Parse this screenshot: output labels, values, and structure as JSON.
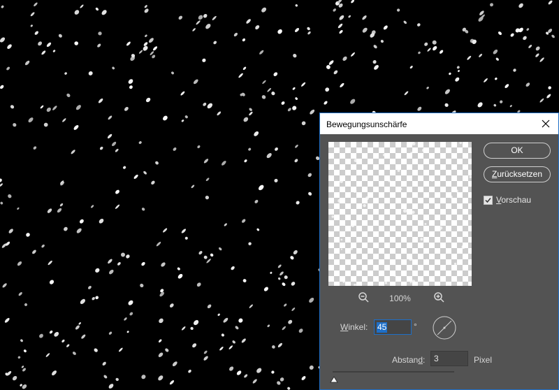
{
  "dialog": {
    "title": "Bewegungsunschärfe",
    "ok_label": "OK",
    "reset_label": "Zurücksetzen",
    "preview_checkbox": {
      "label_prefix": "",
      "label_mnemonic": "V",
      "label_rest": "orschau",
      "checked": true
    },
    "zoom_value": "100%",
    "angle": {
      "label_mnemonic": "W",
      "label_rest": "inkel:",
      "value": "45",
      "unit": "°"
    },
    "distance": {
      "label_prefix": "Abstan",
      "label_mnemonic": "d",
      "label_suffix": ":",
      "value": "3",
      "unit": "Pixel"
    },
    "slider_fraction": 0.0
  },
  "colors": {
    "dialog_bg": "#535353",
    "accent": "#1e6fc8",
    "text": "#d6d6d6"
  }
}
